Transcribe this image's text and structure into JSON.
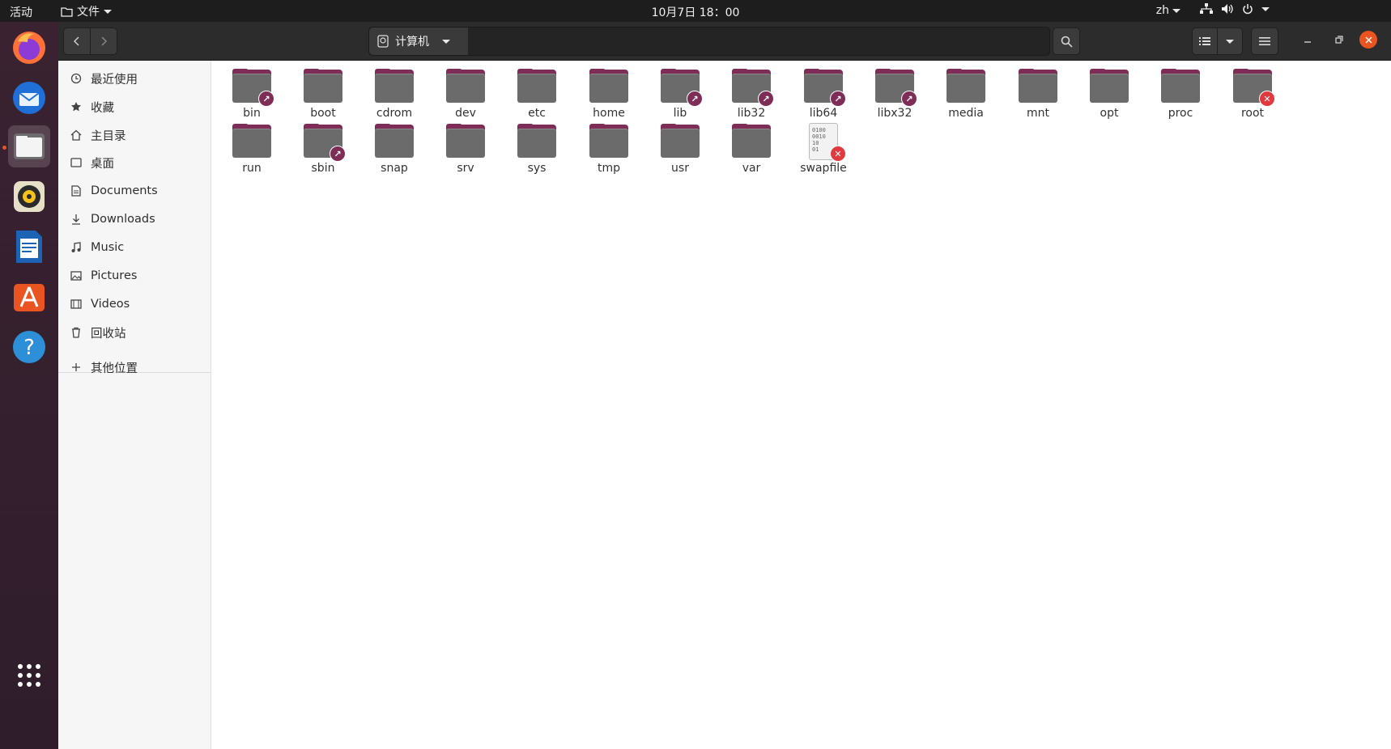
{
  "topbar": {
    "activities": "活动",
    "app_menu": "文件",
    "clock": "10月7日  18：00",
    "language": "zh"
  },
  "toolbar": {
    "location": "计算机"
  },
  "sidebar": {
    "items": [
      {
        "label": "最近使用",
        "icon": "clock-icon"
      },
      {
        "label": "收藏",
        "icon": "star-icon"
      },
      {
        "label": "主目录",
        "icon": "home-icon"
      },
      {
        "label": "桌面",
        "icon": "desktop-icon"
      },
      {
        "label": "Documents",
        "icon": "document-icon"
      },
      {
        "label": "Downloads",
        "icon": "download-icon"
      },
      {
        "label": "Music",
        "icon": "music-icon"
      },
      {
        "label": "Pictures",
        "icon": "picture-icon"
      },
      {
        "label": "Videos",
        "icon": "video-icon"
      },
      {
        "label": "回收站",
        "icon": "trash-icon"
      }
    ],
    "other": {
      "label": "其他位置",
      "icon": "plus-icon"
    }
  },
  "files": [
    {
      "name": "bin",
      "type": "folder",
      "emblem": "link"
    },
    {
      "name": "boot",
      "type": "folder",
      "emblem": ""
    },
    {
      "name": "cdrom",
      "type": "folder",
      "emblem": ""
    },
    {
      "name": "dev",
      "type": "folder",
      "emblem": ""
    },
    {
      "name": "etc",
      "type": "folder",
      "emblem": ""
    },
    {
      "name": "home",
      "type": "folder",
      "emblem": ""
    },
    {
      "name": "lib",
      "type": "folder",
      "emblem": "link"
    },
    {
      "name": "lib32",
      "type": "folder",
      "emblem": "link"
    },
    {
      "name": "lib64",
      "type": "folder",
      "emblem": "link"
    },
    {
      "name": "libx32",
      "type": "folder",
      "emblem": "link"
    },
    {
      "name": "media",
      "type": "folder",
      "emblem": ""
    },
    {
      "name": "mnt",
      "type": "folder",
      "emblem": ""
    },
    {
      "name": "opt",
      "type": "folder",
      "emblem": ""
    },
    {
      "name": "proc",
      "type": "folder",
      "emblem": ""
    },
    {
      "name": "root",
      "type": "folder",
      "emblem": "lock"
    },
    {
      "name": "run",
      "type": "folder",
      "emblem": ""
    },
    {
      "name": "sbin",
      "type": "folder",
      "emblem": "link"
    },
    {
      "name": "snap",
      "type": "folder",
      "emblem": ""
    },
    {
      "name": "srv",
      "type": "folder",
      "emblem": ""
    },
    {
      "name": "sys",
      "type": "folder",
      "emblem": ""
    },
    {
      "name": "tmp",
      "type": "folder",
      "emblem": ""
    },
    {
      "name": "usr",
      "type": "folder",
      "emblem": ""
    },
    {
      "name": "var",
      "type": "folder",
      "emblem": ""
    },
    {
      "name": "swapfile",
      "type": "binary",
      "emblem": "lock"
    }
  ],
  "binary_preview": "0100\n0010\n10\n01"
}
